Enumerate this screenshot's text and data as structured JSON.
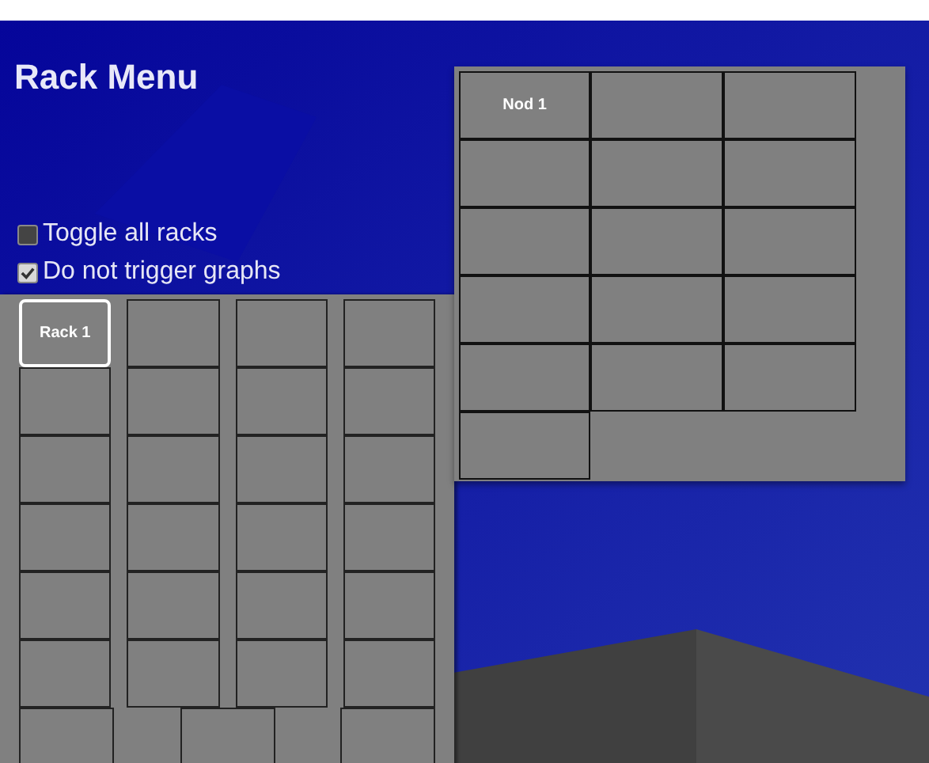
{
  "title": "Rack Menu",
  "options": [
    {
      "label": "Toggle all racks",
      "checked": false
    },
    {
      "label": "Do not trigger graphs",
      "checked": true
    }
  ],
  "rack_rows": [
    {
      "racks": [
        {
          "label": "Rack 1",
          "selected": true
        },
        {
          "selected": false
        },
        {
          "selected": false
        },
        {
          "selected": false
        }
      ]
    },
    {
      "racks": [
        {
          "selected": false
        },
        {
          "selected": false
        },
        {
          "selected": false
        },
        {
          "selected": false
        }
      ]
    },
    {
      "racks": [
        {
          "selected": false
        },
        {
          "selected": false
        },
        {
          "selected": false
        },
        {
          "selected": false
        }
      ]
    },
    {
      "racks": [
        {
          "selected": false
        },
        {
          "selected": false
        },
        {
          "selected": false
        },
        {
          "selected": false
        }
      ]
    },
    {
      "racks": [
        {
          "selected": false
        },
        {
          "selected": false
        },
        {
          "selected": false
        },
        {
          "selected": false
        }
      ]
    },
    {
      "racks": [
        {
          "selected": false
        },
        {
          "selected": false
        },
        {
          "selected": false
        },
        {
          "selected": false
        }
      ]
    },
    {
      "racks": [
        {
          "selected": false
        },
        {
          "selected": false
        },
        {
          "selected": false
        }
      ]
    }
  ],
  "nodes": [
    {
      "kind": "node",
      "label": "Nod 1"
    },
    {
      "kind": "node"
    },
    {
      "kind": "node"
    },
    {
      "kind": "node"
    },
    {
      "kind": "node"
    },
    {
      "kind": "node"
    },
    {
      "kind": "node"
    },
    {
      "kind": "node"
    },
    {
      "kind": "node"
    },
    {
      "kind": "node"
    },
    {
      "kind": "node"
    },
    {
      "kind": "node"
    },
    {
      "kind": "node"
    },
    {
      "kind": "node"
    },
    {
      "kind": "node"
    },
    {
      "kind": "node"
    }
  ]
}
